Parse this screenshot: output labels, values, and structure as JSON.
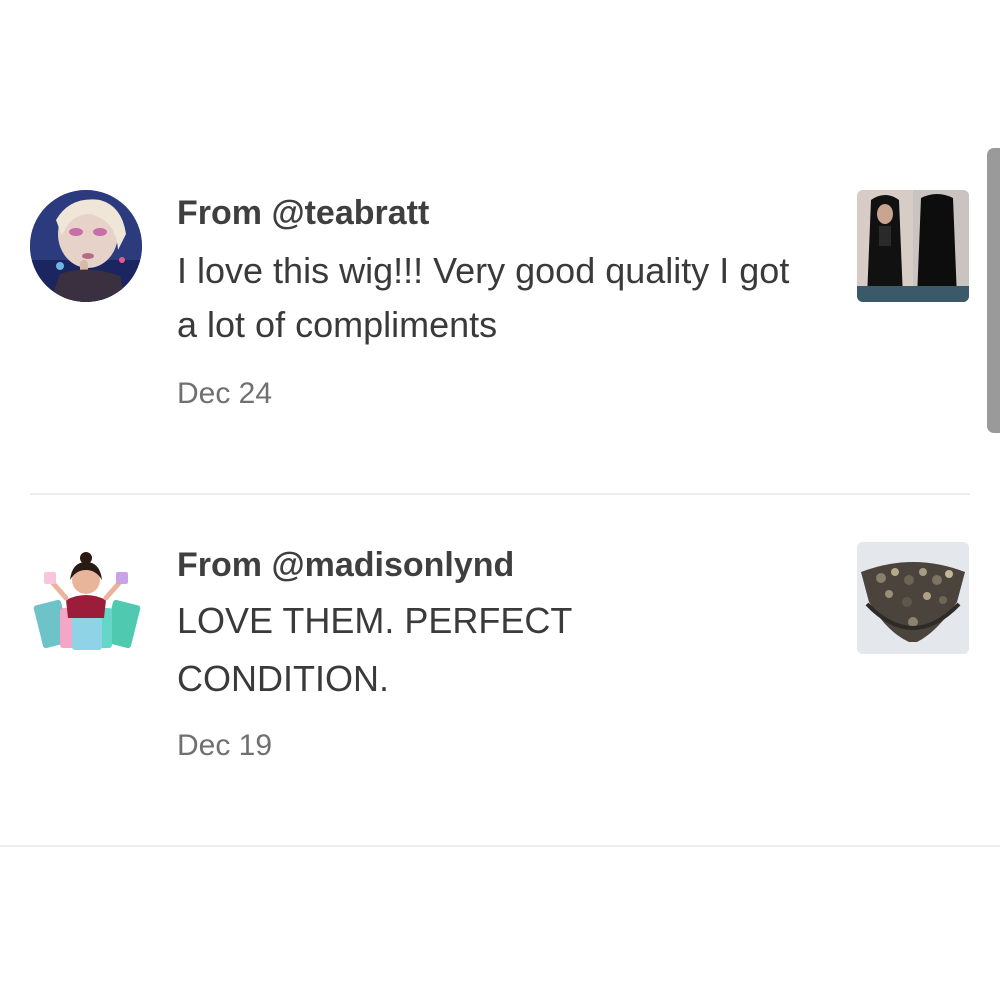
{
  "reviews": [
    {
      "from": "From @teabratt",
      "text": "I love this wig!!! Very good quality I got a lot of compliments",
      "date": "Dec 24"
    },
    {
      "from": "From @madisonlynd",
      "text": "LOVE THEM. PERFECT CONDITION.",
      "date": "Dec 19"
    }
  ],
  "colors": {
    "text_primary": "#3a3a3a",
    "text_secondary": "#707070",
    "divider": "#ececec",
    "scrollbar": "#9a9a9a"
  }
}
